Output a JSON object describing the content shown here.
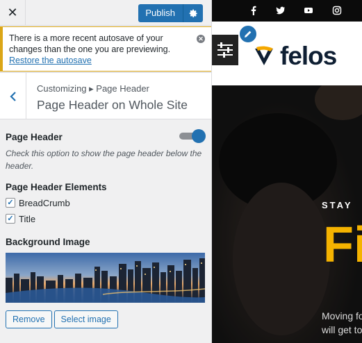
{
  "topbar": {
    "close_glyph": "✕",
    "publish_label": "Publish",
    "settings_icon": "gear-icon"
  },
  "notice": {
    "text": "There is a more recent autosave of your changes than the one you are previewing.",
    "link": "Restore the autosave",
    "dismiss_icon": "dismiss-icon"
  },
  "section": {
    "breadcrumb": "Customizing ▸ Page Header",
    "title": "Page Header on Whole Site",
    "back_icon": "chevron-left-icon"
  },
  "controls": {
    "page_header": {
      "title": "Page Header",
      "enabled": true,
      "description": "Check this option to show the page header below the header."
    },
    "elements": {
      "title": "Page Header Elements",
      "items": [
        {
          "label": "BreadCrumb",
          "checked": true
        },
        {
          "label": "Title",
          "checked": true
        }
      ]
    },
    "background": {
      "title": "Background Image",
      "remove_label": "Remove",
      "select_label": "Select image"
    }
  },
  "preview": {
    "social_icons": [
      "facebook-icon",
      "twitter-icon",
      "youtube-icon",
      "instagram-icon"
    ],
    "logo_text": "felos",
    "hero_stay": "STAY",
    "hero_big": "Fi",
    "hero_sub_1": "Moving fo",
    "hero_sub_2": "will get to"
  },
  "colors": {
    "accent": "#2271b1",
    "notice_border": "#dba617",
    "hero_yellow": "#f5b300"
  }
}
